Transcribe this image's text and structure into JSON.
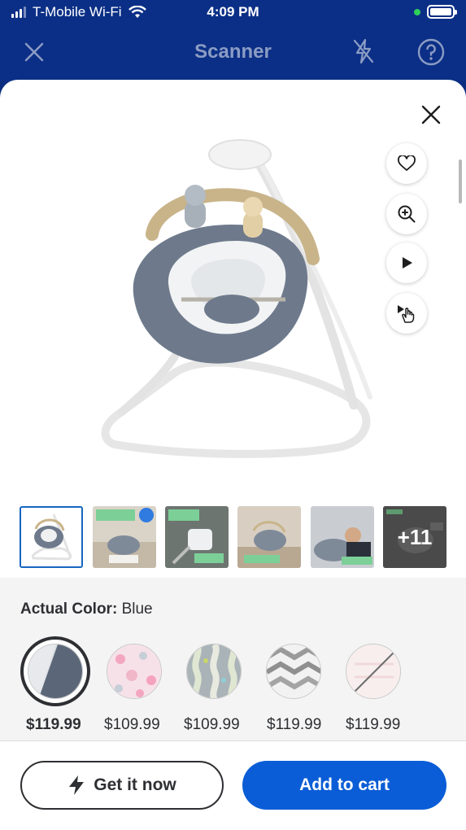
{
  "status_bar": {
    "carrier": "T-Mobile Wi-Fi",
    "time": "4:09 PM"
  },
  "nav": {
    "title": "Scanner",
    "close_icon": "close-icon",
    "flash_icon": "flash-off-icon",
    "help_icon": "help-icon"
  },
  "sheet": {
    "close_icon": "close-icon",
    "side_actions": [
      {
        "name": "favorite-button",
        "icon": "heart-icon"
      },
      {
        "name": "zoom-button",
        "icon": "zoom-in-icon"
      },
      {
        "name": "play-video-button",
        "icon": "play-icon"
      },
      {
        "name": "interactive-view-button",
        "icon": "play-hand-icon"
      }
    ],
    "product_image": {
      "alt": "product-image"
    },
    "thumbnails": [
      {
        "name": "thumbnail-1",
        "selected": true
      },
      {
        "name": "thumbnail-2",
        "selected": false
      },
      {
        "name": "thumbnail-3",
        "selected": false
      },
      {
        "name": "thumbnail-4",
        "selected": false
      },
      {
        "name": "thumbnail-5",
        "selected": false
      },
      {
        "name": "thumbnail-more",
        "selected": false,
        "label": "+11"
      }
    ],
    "color": {
      "label": "Actual Color:",
      "value": "Blue"
    },
    "swatches": [
      {
        "name": "swatch-blue",
        "price": "$119.99",
        "selected": true
      },
      {
        "name": "swatch-pink",
        "price": "$109.99",
        "selected": false
      },
      {
        "name": "swatch-gray-pattern",
        "price": "$109.99",
        "selected": false
      },
      {
        "name": "swatch-gray-chevron",
        "price": "$119.99",
        "selected": false
      },
      {
        "name": "swatch-unavailable",
        "price": "$119.99",
        "selected": false
      }
    ]
  },
  "actions": {
    "get_it_now": "Get it now",
    "add_to_cart": "Add to cart"
  },
  "colors": {
    "brand_blue": "#0b2f86",
    "cart_blue": "#0a5dd6",
    "text_dark": "#2e2f32"
  }
}
